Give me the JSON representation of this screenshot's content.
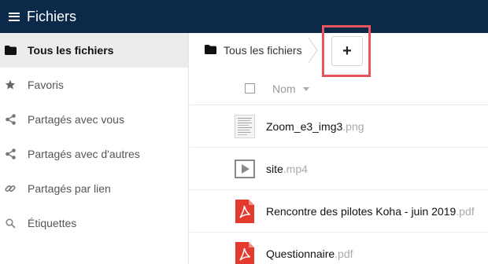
{
  "app": {
    "title": "Fichiers",
    "icons": {
      "menu": "hamburger-icon"
    }
  },
  "sidebar": {
    "items": [
      {
        "label": "Tous les fichiers",
        "icon": "folder-icon",
        "active": true
      },
      {
        "label": "Favoris",
        "icon": "star-icon",
        "active": false
      },
      {
        "label": "Partagés avec vous",
        "icon": "share-icon",
        "active": false
      },
      {
        "label": "Partagés avec d'autres",
        "icon": "share-icon",
        "active": false
      },
      {
        "label": "Partagés par lien",
        "icon": "link-icon",
        "active": false
      },
      {
        "label": "Étiquettes",
        "icon": "search-icon",
        "active": false
      }
    ]
  },
  "breadcrumb": {
    "label": "Tous les fichiers",
    "icon": "folder-icon"
  },
  "toolbar": {
    "add_label": "+",
    "highlight_color": "#e9545c"
  },
  "table": {
    "column_name": "Nom",
    "files": [
      {
        "name": "Zoom_e3_img3",
        "ext": ".png",
        "icon": "image-thumbnail-icon"
      },
      {
        "name": "site",
        "ext": ".mp4",
        "icon": "video-icon"
      },
      {
        "name": "Rencontre des pilotes Koha - juin 2019",
        "ext": ".pdf",
        "icon": "pdf-icon"
      },
      {
        "name": "Questionnaire",
        "ext": ".pdf",
        "icon": "pdf-icon"
      }
    ]
  },
  "colors": {
    "topbar": "#0b2a4a",
    "active_item": "#ececec",
    "pdf": "#e4392f"
  }
}
